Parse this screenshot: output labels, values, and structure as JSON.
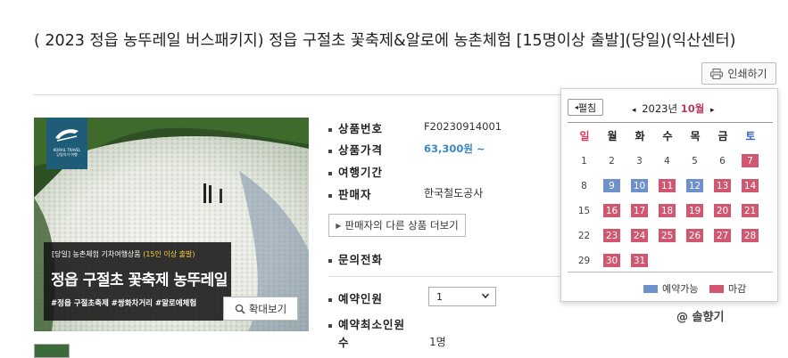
{
  "product": {
    "title": "( 2023 정읍 농뚜레일 버스패키지) 정읍 구절초 꽃축제&알로에 농촌체험 [15명이상 출발](당일)(익산센터)"
  },
  "toolbar": {
    "print_label": "인쇄하기"
  },
  "image": {
    "logo_text": "KORAIL TRAVEL",
    "logo_sub": "당일치기 여행",
    "banner_prefix": "[당일] 농촌체험 기차여행상품",
    "banner_highlight": "(15인 이상 출발)",
    "banner_title": "정읍 구절초 꽃축제 농뚜레일",
    "banner_tags": "#정읍 구절초축제 #쌍화차거리 #알로에체험",
    "zoom_label": "확대보기"
  },
  "info": {
    "code_label": "상품번호",
    "code_value": "F20230914001",
    "price_label": "상품가격",
    "price_value": "63,300원 ~",
    "period_label": "여행기간",
    "seller_label": "판매자",
    "seller_value": "한국철도공사",
    "seller_button": "판매자의 다른 상품 더보기",
    "inquiry_label": "문의전화",
    "reserve_label": "예약인원",
    "reserve_value": "1",
    "min_label_1": "예약최소인원",
    "min_label_2": "수",
    "min_value": "1명"
  },
  "calendar": {
    "fold_label": "펼침",
    "year": "2023년",
    "month": "10월",
    "prev_icon": "◂",
    "next_icon": "▸",
    "weekdays": [
      "일",
      "월",
      "화",
      "수",
      "목",
      "금",
      "토"
    ],
    "weeks": [
      [
        {
          "d": "1",
          "s": ""
        },
        {
          "d": "2",
          "s": ""
        },
        {
          "d": "3",
          "s": ""
        },
        {
          "d": "4",
          "s": ""
        },
        {
          "d": "5",
          "s": ""
        },
        {
          "d": "6",
          "s": ""
        },
        {
          "d": "7",
          "s": "closed"
        }
      ],
      [
        {
          "d": "8",
          "s": ""
        },
        {
          "d": "9",
          "s": "avail"
        },
        {
          "d": "10",
          "s": "avail"
        },
        {
          "d": "11",
          "s": "closed"
        },
        {
          "d": "12",
          "s": "avail"
        },
        {
          "d": "13",
          "s": "closed"
        },
        {
          "d": "14",
          "s": "closed"
        }
      ],
      [
        {
          "d": "15",
          "s": ""
        },
        {
          "d": "16",
          "s": "closed"
        },
        {
          "d": "17",
          "s": "closed"
        },
        {
          "d": "18",
          "s": "closed"
        },
        {
          "d": "19",
          "s": "closed"
        },
        {
          "d": "20",
          "s": "closed"
        },
        {
          "d": "21",
          "s": "closed"
        }
      ],
      [
        {
          "d": "22",
          "s": ""
        },
        {
          "d": "23",
          "s": "closed"
        },
        {
          "d": "24",
          "s": "closed"
        },
        {
          "d": "25",
          "s": "closed"
        },
        {
          "d": "26",
          "s": "closed"
        },
        {
          "d": "27",
          "s": "closed"
        },
        {
          "d": "28",
          "s": "closed"
        }
      ],
      [
        {
          "d": "29",
          "s": ""
        },
        {
          "d": "30",
          "s": "closed"
        },
        {
          "d": "31",
          "s": "closed"
        }
      ]
    ],
    "legend_available": "예약가능",
    "legend_closed": "마감",
    "colors": {
      "available": "#6e91cd",
      "closed": "#d1566f",
      "sunday": "#e2385a",
      "saturday": "#3a66c8",
      "month": "#b4405e"
    }
  },
  "watermark": "@ 솔향기"
}
